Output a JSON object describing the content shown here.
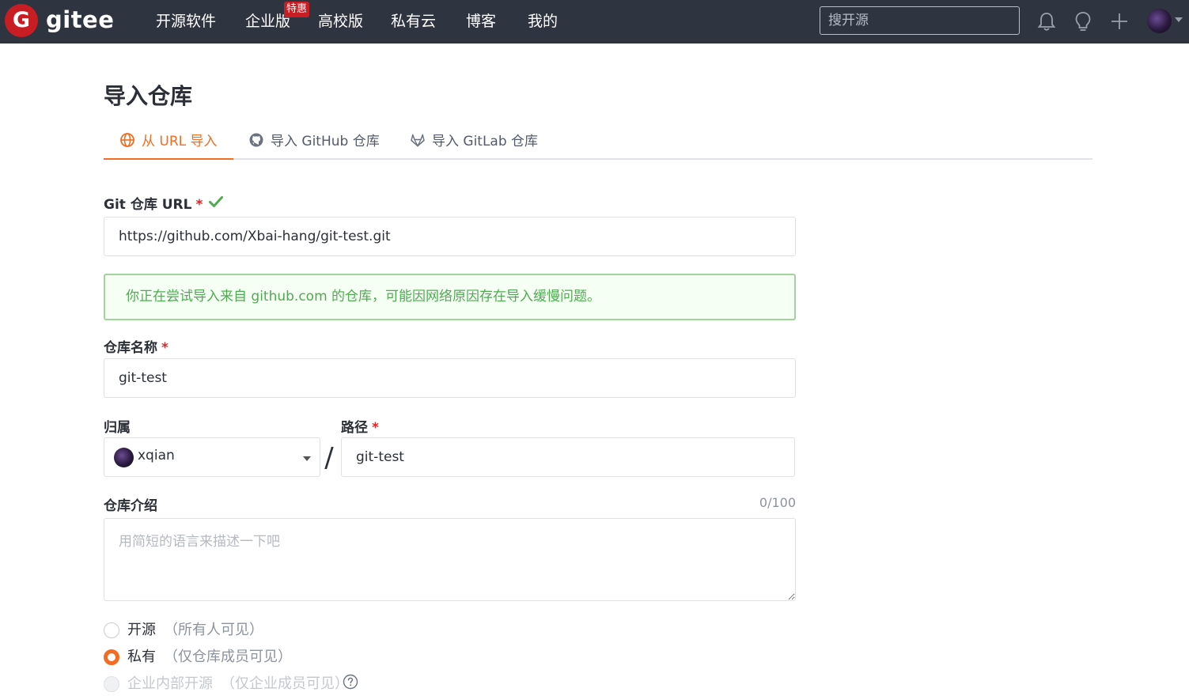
{
  "header": {
    "logo_letter": "G",
    "logo_text": "gitee",
    "nav": [
      {
        "label": "开源软件"
      },
      {
        "label": "企业版"
      },
      {
        "label": "高校版"
      },
      {
        "label": "私有云"
      },
      {
        "label": "博客"
      },
      {
        "label": "我的"
      }
    ],
    "hot_badge": "特惠",
    "search_placeholder": "搜开源",
    "icons": [
      "bell-icon",
      "lightbulb-icon",
      "plus-icon",
      "user-avatar"
    ]
  },
  "page": {
    "title": "导入仓库",
    "tabs": [
      {
        "label": "从 URL 导入",
        "icon": "globe-icon",
        "active": true
      },
      {
        "label": "导入 GitHub 仓库",
        "icon": "github-icon",
        "active": false
      },
      {
        "label": "导入 GitLab 仓库",
        "icon": "gitlab-icon",
        "active": false
      }
    ]
  },
  "form": {
    "url_label": "Git 仓库 URL",
    "required_mark": "*",
    "url_value": "https://github.com/Xbai-hang/git-test.git",
    "notice": "你正在尝试导入来自 github.com 的仓库，可能因网络原因存在导入缓慢问题。",
    "name_label": "仓库名称",
    "name_value": "git-test",
    "owner_label": "归属",
    "owner_value": "xqian",
    "path_label": "路径",
    "path_separator": "/",
    "path_value": "git-test",
    "desc_label": "仓库介绍",
    "desc_counter": "0/100",
    "desc_placeholder": "用简短的语言来描述一下吧",
    "visibility": [
      {
        "label": "开源",
        "hint": "（所有人可见）",
        "checked": false,
        "disabled": false
      },
      {
        "label": "私有",
        "hint": "（仅仓库成员可见）",
        "checked": true,
        "disabled": false
      },
      {
        "label": "企业内部开源",
        "hint": "（仅企业成员可见）",
        "checked": false,
        "disabled": true
      }
    ]
  },
  "colors": {
    "topbar": "#2e3440",
    "brand_red": "#c71d23",
    "accent_orange": "#f26c22",
    "success_green": "#4fab52"
  }
}
